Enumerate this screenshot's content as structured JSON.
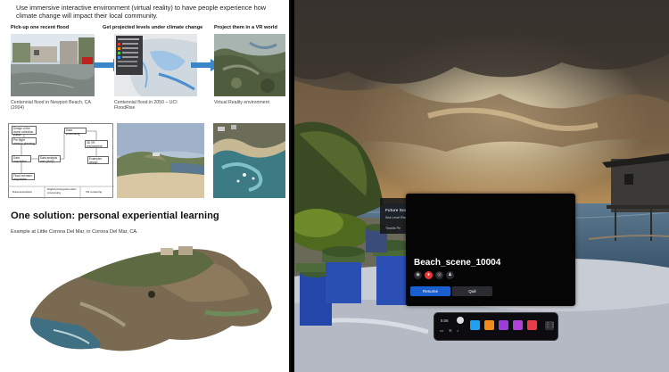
{
  "slide": {
    "intro": "Use immersive interactive environment (virtual reality) to have people experience how climate change will impact their local community.",
    "steps": [
      {
        "title": "Pick-up one recent flood",
        "caption": "Centennial flood in Newport Beach, CA (2004)"
      },
      {
        "title": "Get projected levels under climate change",
        "caption": "Centennial flood in 2050 – UCI FloodRise"
      },
      {
        "title": "Project them in a VR world",
        "caption": "Virtual Reality environment"
      }
    ],
    "workflow": {
      "boxes": [
        "Design of the drone collection phase",
        "Pre-flight mission planning",
        "Data acquisition",
        "Flood scenario acquisition",
        "Data analysis and QA/QC",
        "Data processing",
        "3D VR environment",
        "Examples design"
      ],
      "phases": [
        "Data acquisition",
        "Digital photogrammetric processing",
        "VR rendering"
      ]
    },
    "solution_title": "One solution: personal experiential learning",
    "solution_sub": "Example at Little Corona Del Mar, in Corona Del Mar, CA."
  },
  "vr": {
    "panel_title": "Beach_scene_10004",
    "resume_label": "Resume",
    "quit_label": "Quit",
    "ghost_title": "Future Scen",
    "ghost_line": "Sea Level Rise",
    "ghost_line2": "Tlmelle Pe",
    "dock_time": "6:06",
    "colors": {
      "resume": "#1a5fd0",
      "quit": "#2b2c31",
      "record": "#e8333a"
    },
    "dock_apps": [
      {
        "icon": "meta-quest-icon",
        "color": "#1fa0f0"
      },
      {
        "icon": "store-bag-icon",
        "color": "#f08a1c"
      },
      {
        "icon": "media-gallery-icon",
        "color": "#9b3fd6"
      },
      {
        "icon": "people-icon",
        "color": "#b042d8"
      },
      {
        "icon": "share-arrow-icon",
        "color": "#e83c4a"
      }
    ]
  }
}
